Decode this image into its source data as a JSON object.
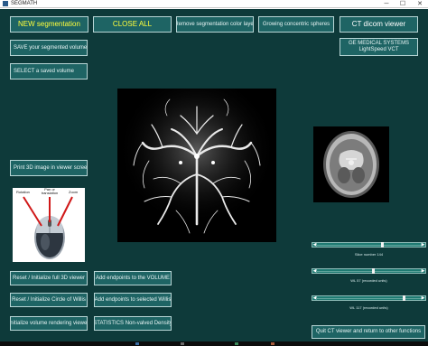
{
  "window": {
    "title": "SEGMATH",
    "controls": {
      "minimize": "─",
      "maximize": "☐",
      "close": "✕"
    }
  },
  "buttons": {
    "new_segmentation": "NEW segmentation",
    "close_all": "CLOSE ALL",
    "remove_segmentation_color_layer": "Remove segmentation color layer",
    "growing_concentric_spheres": "Growing concentric spheres",
    "ct_dicom_viewer": "CT dicom viewer",
    "save_segmented_volume": "SAVE your segmented volume",
    "select_saved_volume": "SELECT a saved volume",
    "print_3d_image": "Print 3D image in viewer screen",
    "reset_full_3d_viewer": "Reset / Initialize full 3D viewer",
    "reset_circle_of_willis": "Reset / Initialize Circle of Willis",
    "initialize_volume_rendering": "Initialize volume rendering viewer",
    "add_endpoints_volume": "Add endpoints to the VOLUME",
    "add_endpoints_willis": "Add endpoints to selected Willis",
    "statistics_non_valved_density": "STATISTICS Non-valved Density",
    "quit_ct_viewer": "Quit CT viewer and return to other functions"
  },
  "scanner_label": {
    "line1": "GE MEDICAL SYSTEMS",
    "line2": "LightSpeed VCT"
  },
  "mouse_diagram": {
    "label_left": "Rotation",
    "label_middle": "Pan or translation",
    "label_right": "Zoom"
  },
  "sliders": [
    {
      "caption": "Slice number 144",
      "value": 0.6
    },
    {
      "caption": "WL 57 (recorded units)",
      "value": 0.52
    },
    {
      "caption": "WL 117 (recorded units)",
      "value": 0.8
    }
  ],
  "colors": {
    "window_bg": "#0e3a3a",
    "button_bg": "#1e6464",
    "button_border": "#b8d6d6",
    "highlight_text": "#ffff3c",
    "slider_bg": "#1f7a72"
  }
}
